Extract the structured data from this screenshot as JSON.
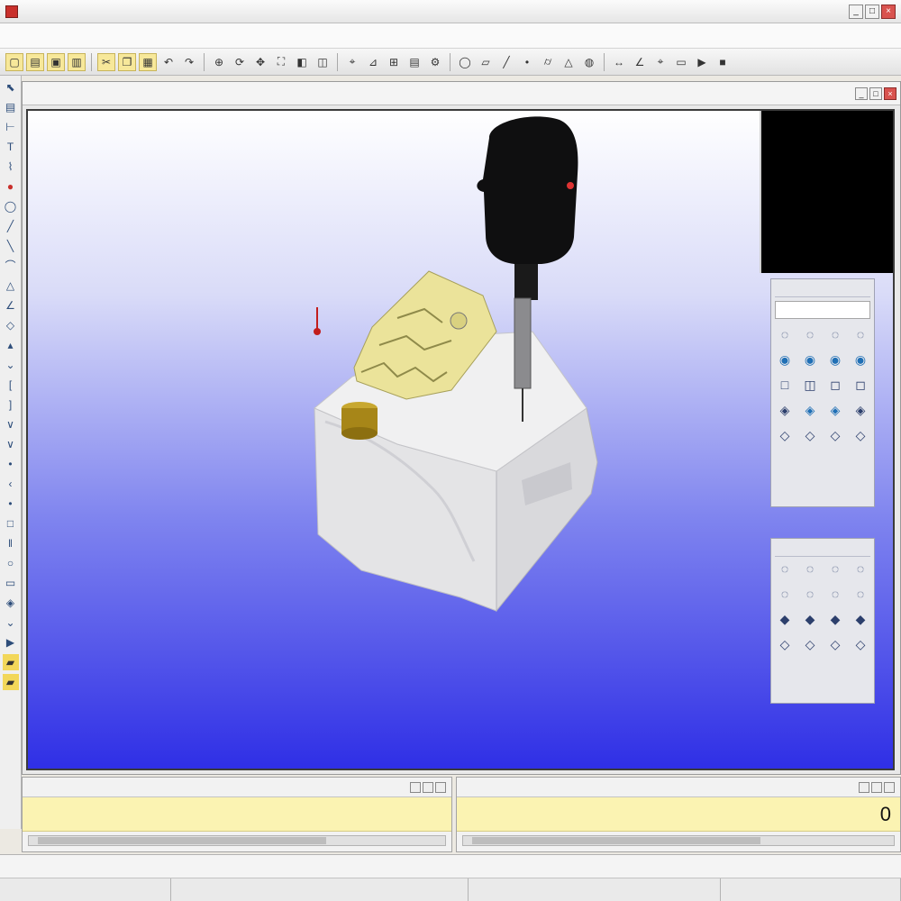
{
  "app": {
    "title": "",
    "window_buttons": [
      "_",
      "□",
      "×"
    ]
  },
  "menubar": {
    "items": [
      "",
      "",
      "",
      "",
      "",
      "",
      "",
      "",
      "",
      ""
    ]
  },
  "toolbar": {
    "buttons": [
      {
        "icon": "new-icon"
      },
      {
        "icon": "open-icon"
      },
      {
        "icon": "save-icon"
      },
      {
        "icon": "print-icon"
      },
      {
        "icon": "cut-icon"
      },
      {
        "icon": "copy-icon"
      },
      {
        "icon": "paste-icon"
      },
      {
        "icon": "undo-icon"
      },
      {
        "icon": "redo-icon"
      },
      {
        "icon": "zoom-icon"
      },
      {
        "icon": "rotate-icon"
      },
      {
        "icon": "pan-icon"
      },
      {
        "icon": "fit-icon"
      },
      {
        "icon": "shade-icon"
      },
      {
        "icon": "wire-icon"
      },
      {
        "icon": "probe-icon"
      },
      {
        "icon": "measure-icon"
      },
      {
        "icon": "align-icon"
      },
      {
        "icon": "report-icon"
      },
      {
        "icon": "settings-icon"
      }
    ]
  },
  "viewport": {
    "title": "",
    "buttons": [
      "_",
      "□",
      "×"
    ]
  },
  "info_panel": {
    "header": "",
    "lines": [
      "",
      "",
      ""
    ]
  },
  "palette1": {
    "title": "",
    "input_value": "",
    "buttons": [
      "◌",
      "◌",
      "◌",
      "◌",
      "◉",
      "◉",
      "◉",
      "◉",
      "□",
      "◫",
      "◻",
      "◻",
      "◈",
      "◈",
      "◈",
      "◈",
      "◇",
      "◇",
      "◇",
      "◇"
    ]
  },
  "palette2": {
    "title": "",
    "buttons": [
      "◌",
      "◌",
      "◌",
      "◌",
      "◌",
      "◌",
      "◌",
      "◌",
      "◆",
      "◆",
      "◆",
      "◆",
      "◇",
      "◇",
      "◇",
      "◇"
    ]
  },
  "bottom_left": {
    "title": "",
    "row_text": ""
  },
  "bottom_right": {
    "title": "",
    "row_text": "",
    "value": "0"
  },
  "statusbar": {
    "text": ""
  },
  "statusbar2": {
    "cells": [
      "",
      "",
      "",
      ""
    ]
  },
  "colors": {
    "viewport_top": "#ffffff",
    "viewport_bottom": "#2f2fe6",
    "part": "#e9e9ea",
    "feature_yellow": "#e8e090",
    "probe_head": "#111111",
    "highlight": "#fbf3b2"
  }
}
